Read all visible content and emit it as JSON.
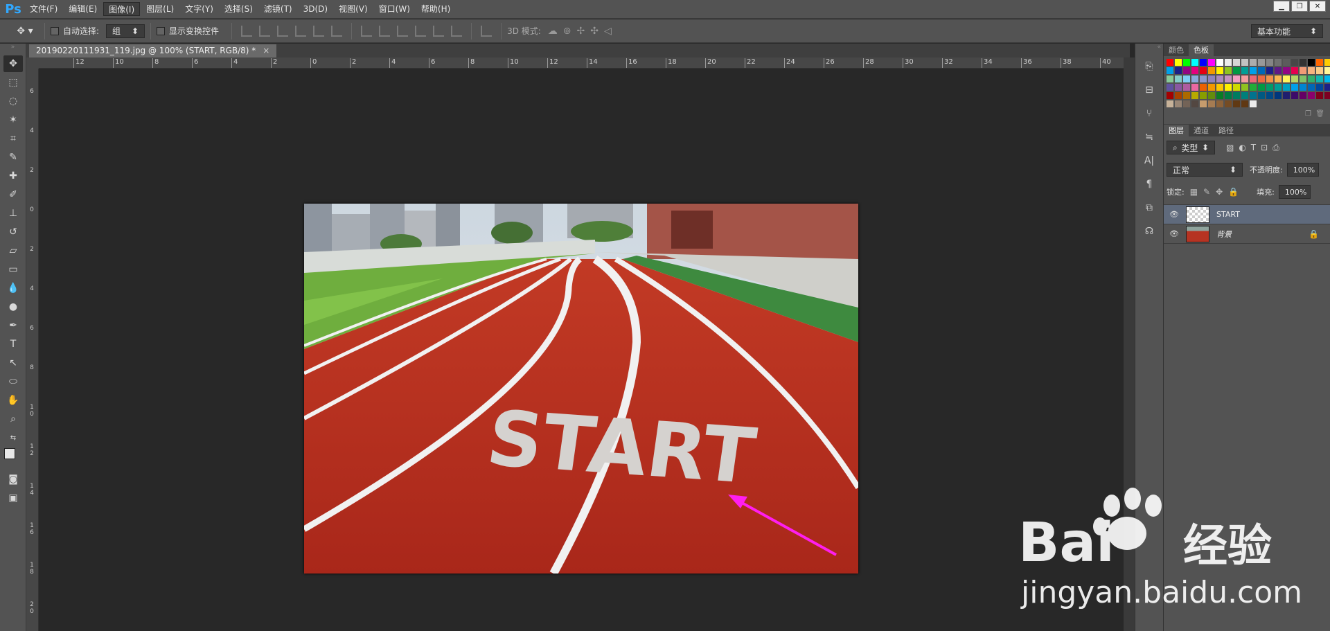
{
  "menubar": {
    "logo": "Ps",
    "items": [
      "文件(F)",
      "编辑(E)",
      "图像(I)",
      "图层(L)",
      "文字(Y)",
      "选择(S)",
      "滤镜(T)",
      "3D(D)",
      "视图(V)",
      "窗口(W)",
      "帮助(H)"
    ]
  },
  "options": {
    "auto_select_label": "自动选择:",
    "auto_select_value": "组",
    "show_transform_label": "显示变换控件",
    "mode_3d_label": "3D 模式:",
    "workspace": "基本功能"
  },
  "document": {
    "tab_title": "20190220111931_119.jpg @ 100% (START, RGB/8) *",
    "close": "×"
  },
  "ruler": {
    "h_ticks": [
      "12",
      "10",
      "8",
      "6",
      "4",
      "2",
      "0",
      "2",
      "4",
      "6",
      "8",
      "10",
      "12",
      "14",
      "16",
      "18",
      "20",
      "22",
      "24",
      "26",
      "28",
      "30",
      "32",
      "34",
      "36",
      "38",
      "40"
    ],
    "v_ticks": [
      "6",
      "4",
      "2",
      "0",
      "2",
      "4",
      "6",
      "8",
      "1 0",
      "1 2",
      "1 4",
      "1 6",
      "1 8",
      "2 0"
    ]
  },
  "canvas": {
    "text_on_track": "START"
  },
  "panels": {
    "color_tabs": [
      "颜色",
      "色板"
    ],
    "layer_tabs": [
      "图层",
      "通道",
      "路径"
    ],
    "filter_kind": "类型",
    "blend_mode": "正常",
    "opacity_label": "不透明度:",
    "opacity_value": "100%",
    "lock_label": "锁定:",
    "fill_label": "填充:",
    "fill_value": "100%",
    "layers": [
      {
        "name": "START",
        "selected": true
      },
      {
        "name": "背景",
        "selected": false
      }
    ]
  },
  "swatch_colors": [
    "#ff0000",
    "#ffff00",
    "#00ff00",
    "#00ffff",
    "#0000ff",
    "#ff00ff",
    "#ffffff",
    "#ebebeb",
    "#d6d6d6",
    "#c2c2c2",
    "#adadad",
    "#999999",
    "#858585",
    "#707070",
    "#5c5c5c",
    "#474747",
    "#333333",
    "#000000",
    "#ff6600",
    "#ffcc00",
    "#ccff00",
    "#00cc66",
    "#00a0e9",
    "#1d2088",
    "#920783",
    "#e4007f",
    "#e60012",
    "#f39800",
    "#fff100",
    "#8fc31f",
    "#009944",
    "#009e96",
    "#00a0e9",
    "#0068b7",
    "#1d2088",
    "#601986",
    "#920783",
    "#e5004f",
    "#f29b76",
    "#f6b37f",
    "#facd89",
    "#fff799",
    "#cce198",
    "#acd598",
    "#89c997",
    "#84ccc9",
    "#7ecef4",
    "#88abda",
    "#8c97cb",
    "#8f82bc",
    "#aa89bd",
    "#c490bf",
    "#f19ec2",
    "#f29c9f",
    "#eb6877",
    "#ec6941",
    "#f19149",
    "#f8b551",
    "#fff45c",
    "#b3d465",
    "#80c269",
    "#32b16c",
    "#13b5b1",
    "#00b7ee",
    "#448aca",
    "#556fb5",
    "#5f52a0",
    "#8957a1",
    "#ae5da1",
    "#ea68a2",
    "#eb6100",
    "#f39800",
    "#fcc800",
    "#fff100",
    "#cfdb00",
    "#8fc31f",
    "#22ac38",
    "#009944",
    "#009b6b",
    "#009e96",
    "#00a0c1",
    "#00a0e9",
    "#0086d1",
    "#0068b7",
    "#00479d",
    "#1d2088",
    "#601986",
    "#920783",
    "#a40000",
    "#a84200",
    "#ac6a00",
    "#b7aa00",
    "#889e00",
    "#638c0b",
    "#097c25",
    "#007b43",
    "#007c60",
    "#007f7b",
    "#00738e",
    "#005982",
    "#004986",
    "#00377d",
    "#1f1f6e",
    "#3d0b69",
    "#650065",
    "#8b006c",
    "#7f0019",
    "#7e0021",
    "#8a3b00",
    "#8c5a00",
    "#c7b299",
    "#998675",
    "#736357",
    "#534741",
    "#c69c6d",
    "#a67c52",
    "#8c6239",
    "#754c24",
    "#603913",
    "#603813",
    "#ebebeb"
  ]
}
